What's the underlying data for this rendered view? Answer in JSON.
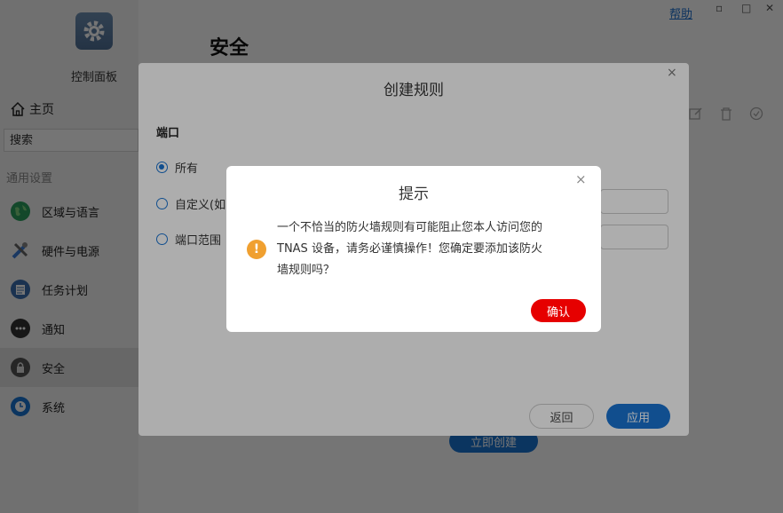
{
  "window": {
    "help_label": "帮助",
    "minimize": "▫",
    "maximize": "□",
    "close": "✕"
  },
  "sidebar": {
    "title": "控制面板",
    "home_label": "主页",
    "search_placeholder": "搜索",
    "section_label": "通用设置",
    "items": [
      {
        "label": "区域与语言",
        "icon": "globe-icon",
        "color": "#2a9d5c"
      },
      {
        "label": "硬件与电源",
        "icon": "tools-icon",
        "color": "#3a7bd5"
      },
      {
        "label": "任务计划",
        "icon": "calendar-icon",
        "color": "#3a6fb0"
      },
      {
        "label": "通知",
        "icon": "chat-bubble-icon",
        "color": "#333333"
      },
      {
        "label": "安全",
        "icon": "lock-icon",
        "color": "#555555"
      },
      {
        "label": "系统",
        "icon": "clock-icon",
        "color": "#1a74d2"
      }
    ]
  },
  "main": {
    "page_title": "安全",
    "create_now_label": "立即创建"
  },
  "rule_dialog": {
    "title": "创建规则",
    "close": "×",
    "port_label": "端口",
    "options": [
      "所有",
      "自定义(如",
      "端口范围"
    ],
    "selected_option": "所有",
    "back_label": "返回",
    "apply_label": "应用"
  },
  "alert": {
    "title": "提示",
    "close": "×",
    "icon": "!",
    "lines": [
      "一个不恰当的防火墙规则有可能阻止您本人访问您的",
      "TNAS 设备，请务必谨慎操作！您确定要添加该防火",
      "墙规则吗？"
    ],
    "confirm_label": "确认"
  },
  "colors": {
    "accent": "#1a74d2",
    "danger": "#e60000",
    "warning": "#f0a030"
  }
}
